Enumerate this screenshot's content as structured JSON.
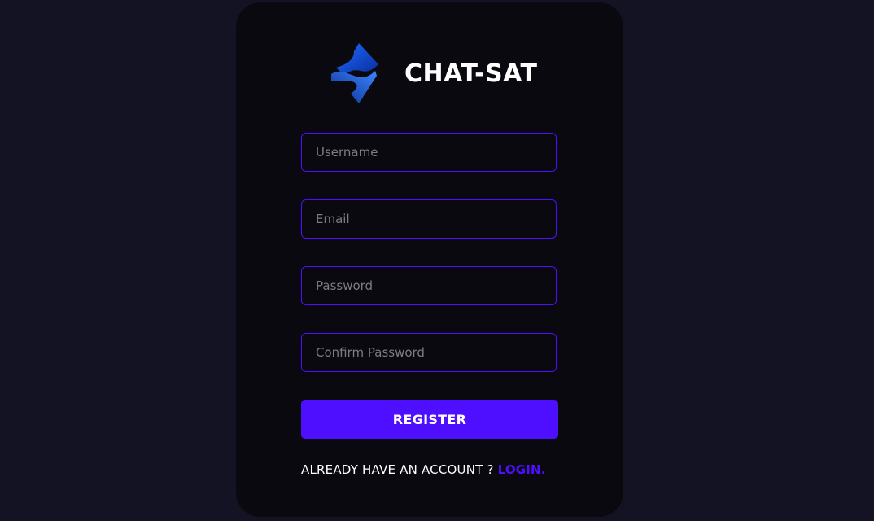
{
  "colors": {
    "page_background": "#131324",
    "card_background": "#09090f",
    "accent": "#4e0eff",
    "text": "#ffffff",
    "placeholder": "#7c7c86"
  },
  "brand": {
    "logo_icon": "stylized-s-logo-icon",
    "name": "CHAT-SAT"
  },
  "form": {
    "username_placeholder": "Username",
    "email_placeholder": "Email",
    "password_placeholder": "Password",
    "confirm_password_placeholder": "Confirm Password",
    "register_label": "REGISTER"
  },
  "footer": {
    "prompt": "ALREADY HAVE AN ACCOUNT ?",
    "login_label": "LOGIN."
  }
}
